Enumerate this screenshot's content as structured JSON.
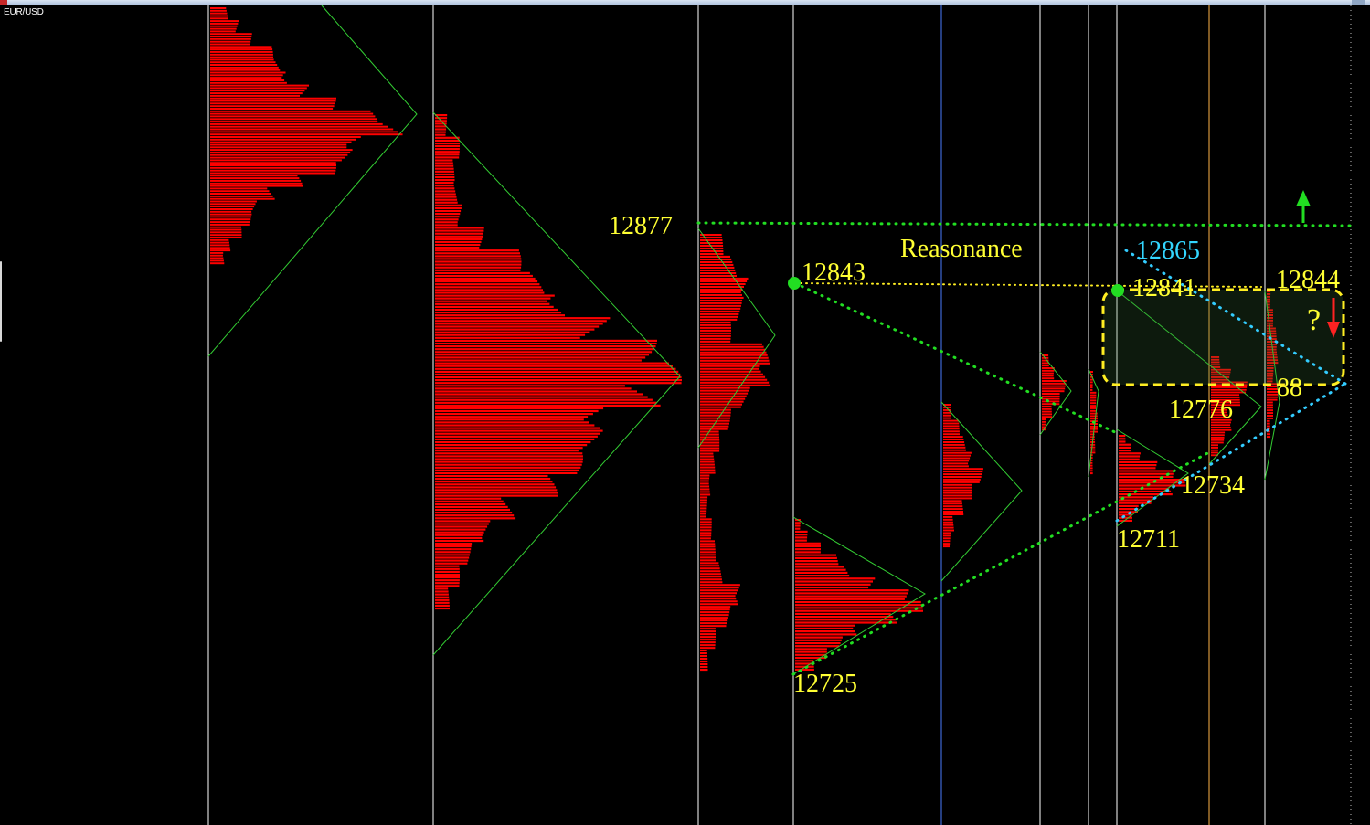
{
  "window": {
    "symbol": "EUR/USD"
  },
  "colors": {
    "background": "#000000",
    "profile": "#ff0000",
    "session_line": "#ffffff",
    "session_line_accent": "#4a7dff",
    "session_line_amber": "#ffb347",
    "triangle": "#33cc33",
    "dotted_green": "#22dd22",
    "dotted_yellow": "#ffee22",
    "dotted_cyan": "#33ccff",
    "label_yellow": "#ffff33",
    "label_cyan": "#33d6ff",
    "arrow_up": "#22dd22",
    "arrow_down": "#ff2222"
  },
  "annotations": {
    "level_12877": "12877",
    "level_12843": "12843",
    "level_12841": "12841",
    "level_12844": "12844",
    "level_12865": "12865",
    "level_12776": "12776",
    "level_12734": "12734",
    "level_12711": "12711",
    "level_12725": "12725",
    "partial_88": "88",
    "reasonance": "Reasonance",
    "question": "?"
  },
  "chart_data": {
    "type": "market_profile",
    "instrument": "EUR/USD",
    "marked_levels": [
      12877,
      12843,
      12841,
      12844,
      12865,
      12776,
      12734,
      12711,
      12725
    ],
    "profiles": [
      {
        "poc_rel": 0.45,
        "widths": [
          0.1,
          0.15,
          0.2,
          0.3,
          0.35,
          0.45,
          0.5,
          0.6,
          0.8,
          1.0,
          0.85,
          0.7,
          0.6,
          0.45,
          0.35,
          0.25,
          0.2,
          0.15,
          0.1,
          0.08
        ]
      },
      {
        "poc_rel": 0.5,
        "widths": [
          0.05,
          0.1,
          0.08,
          0.1,
          0.12,
          0.2,
          0.35,
          0.45,
          0.6,
          0.75,
          0.9,
          1.0,
          0.95,
          0.8,
          0.7,
          0.6,
          0.5,
          0.35,
          0.25,
          0.15,
          0.1,
          0.06
        ]
      },
      {
        "poc_rel": 0.25,
        "widths": [
          0.3,
          0.5,
          0.7,
          0.55,
          0.4,
          0.9,
          1.0,
          0.7,
          0.4,
          0.25,
          0.2,
          0.15,
          0.1,
          0.15,
          0.2,
          0.3,
          0.6,
          0.4,
          0.2,
          0.1
        ]
      },
      {
        "poc_rel": 0.55,
        "widths": [
          0.05,
          0.1,
          0.2,
          0.35,
          0.5,
          0.7,
          0.9,
          1.0,
          0.85,
          0.6,
          0.4,
          0.25,
          0.15
        ]
      },
      {
        "poc_rel": 0.5,
        "widths": [
          0.2,
          0.4,
          0.6,
          0.8,
          1.0,
          0.7,
          0.5,
          0.3,
          0.2
        ]
      },
      {
        "poc_rel": 0.5,
        "widths": [
          0.3,
          0.6,
          1.0,
          0.7,
          0.4,
          0.2
        ]
      },
      {
        "poc_rel": 0.5,
        "widths": [
          0.4,
          0.8,
          1.0,
          0.7,
          0.4
        ]
      },
      {
        "poc_rel": 0.6,
        "widths": [
          0.1,
          0.2,
          0.4,
          0.6,
          0.8,
          1.0,
          0.9,
          0.6,
          0.3,
          0.2
        ]
      },
      {
        "poc_rel": 0.5,
        "widths": [
          0.3,
          0.6,
          1.0,
          0.8,
          0.5,
          0.7,
          0.4,
          0.2
        ]
      },
      {
        "poc_rel": 0.4,
        "widths": [
          0.3,
          0.5,
          0.8,
          1.0,
          0.6,
          0.9,
          0.5,
          0.3
        ]
      }
    ]
  }
}
